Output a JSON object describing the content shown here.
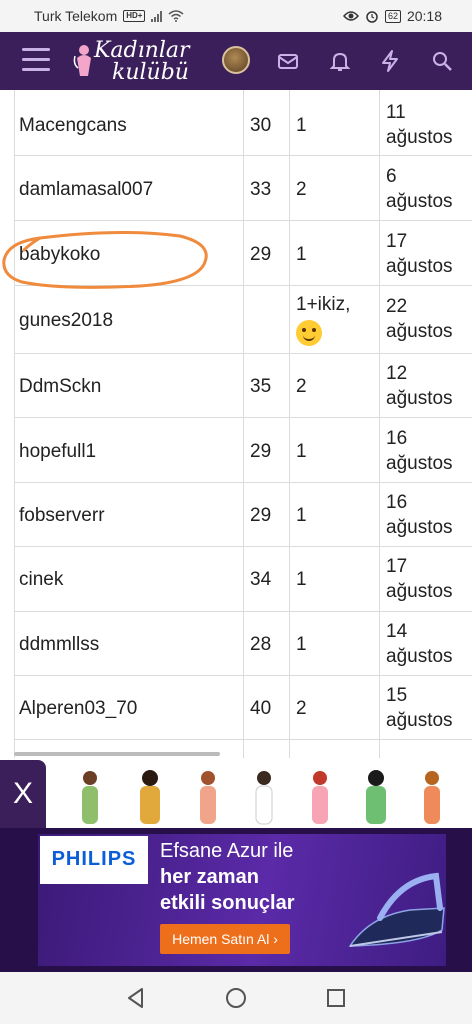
{
  "status_bar": {
    "carrier": "Turk Telekom",
    "network_badge": "HD+",
    "battery": "62",
    "time": "20:18"
  },
  "header": {
    "logo_line1": "Kadınlar",
    "logo_line2": "kulübü",
    "icons": [
      "menu-icon",
      "avatar",
      "mail-icon",
      "bell-icon",
      "lightning-icon",
      "search-icon"
    ],
    "background_color": "#3b1f5a"
  },
  "table": {
    "rows": [
      {
        "name": "Macengcans",
        "age": "30",
        "kids": "1",
        "day": "11",
        "month": "ağustos"
      },
      {
        "name": "damlamasal007",
        "age": "33",
        "kids": "2",
        "day": "6",
        "month": "ağustos"
      },
      {
        "name": "babykoko",
        "age": "29",
        "kids": "1",
        "day": "17",
        "month": "ağustos"
      },
      {
        "name": "gunes2018",
        "age": "",
        "kids": "1+ikiz,",
        "day": "22",
        "month": "ağustos"
      },
      {
        "name": "DdmSckn",
        "age": "35",
        "kids": "2",
        "day": "12",
        "month": "ağustos"
      },
      {
        "name": "hopefull1",
        "age": "29",
        "kids": "1",
        "day": "16",
        "month": "ağustos"
      },
      {
        "name": "fobserverr",
        "age": "29",
        "kids": "1",
        "day": "16",
        "month": "ağustos"
      },
      {
        "name": "cinek",
        "age": "34",
        "kids": "1",
        "day": "17",
        "month": "ağustos"
      },
      {
        "name": "ddmmllss",
        "age": "28",
        "kids": "1",
        "day": "14",
        "month": "ağustos"
      },
      {
        "name": "Alperen03_70",
        "age": "40",
        "kids": "2",
        "day": "15",
        "month": "ağustos"
      }
    ],
    "highlight_color": "#f08a3c"
  },
  "ad": {
    "close_label": "X",
    "brand": "PHILIPS",
    "line1": "Efsane Azur ile",
    "line2": "her zaman",
    "line3": "etkili sonuçlar",
    "cta": "Hemen Satın Al ›",
    "cta_color": "#ee6f1b"
  },
  "nav": {
    "icons": [
      "back-icon",
      "home-icon",
      "recents-icon"
    ]
  }
}
